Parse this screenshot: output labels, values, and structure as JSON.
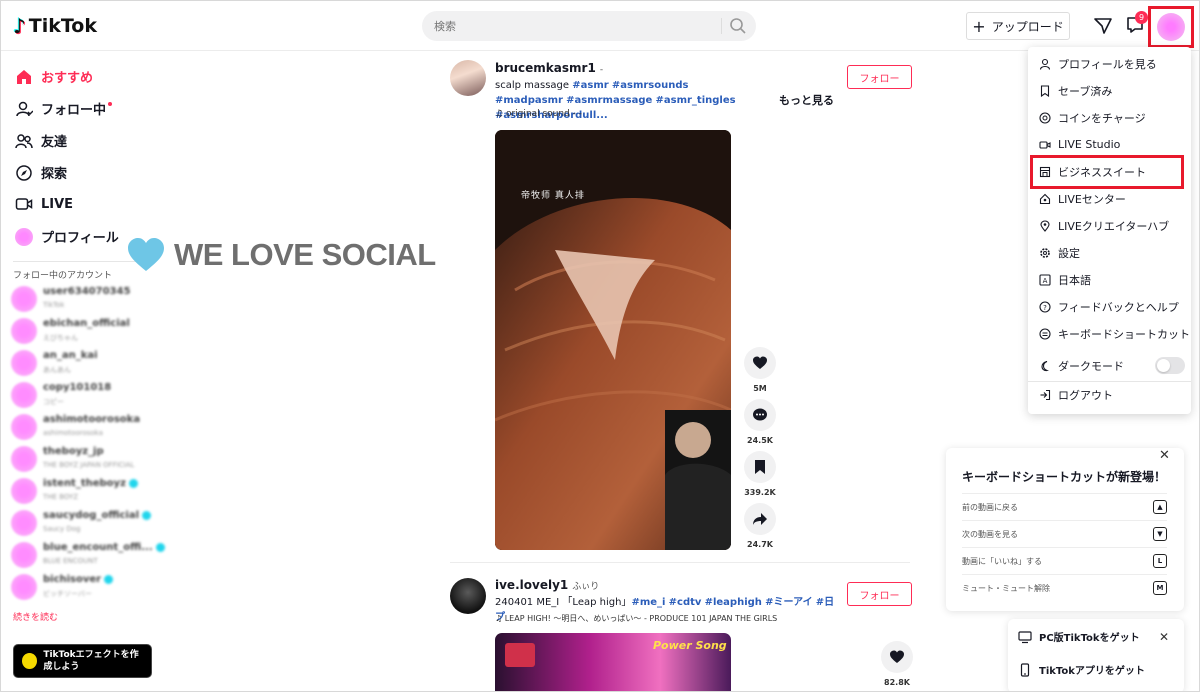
{
  "header": {
    "logo_text": "TikTok",
    "search_placeholder": "検索",
    "upload_label": "アップロード",
    "inbox_badge": "9"
  },
  "sidebar": {
    "nav": [
      {
        "label": "おすすめ",
        "icon": "home-icon",
        "active": true
      },
      {
        "label": "フォロー中",
        "icon": "following-icon"
      },
      {
        "label": "友達",
        "icon": "friends-icon"
      },
      {
        "label": "探索",
        "icon": "explore-icon"
      },
      {
        "label": "LIVE",
        "icon": "live-icon"
      },
      {
        "label": "プロフィール",
        "icon": "profile-avatar"
      }
    ],
    "following_heading": "フォロー中のアカウント",
    "accounts": [
      {
        "name": "user634070345",
        "sub": "TikTok"
      },
      {
        "name": "ebichan_official",
        "sub": "えびちゃん"
      },
      {
        "name": "an_an_kai",
        "sub": "あんあん"
      },
      {
        "name": "copy101018",
        "sub": "コピー"
      },
      {
        "name": "ashimotoorosoka",
        "sub": "ashimotoorosoka"
      },
      {
        "name": "theboyz_jp",
        "sub": "THE BOYZ JAPAN OFFICIAL"
      },
      {
        "name": "istent_theboyz",
        "sub": "THE BOYZ"
      },
      {
        "name": "saucydog_official",
        "sub": "Saucy Dog"
      },
      {
        "name": "blue_encount_offi...",
        "sub": "BLUE ENCOUNT"
      },
      {
        "name": "bichisover",
        "sub": "ビッチソーバー"
      }
    ],
    "see_more": "続きを読む",
    "effect_button": "TikTokエフェクトを作成しよう"
  },
  "watermark": "WE LOVE SOCIAL",
  "feed": {
    "more_label": "もっと見る",
    "posts": [
      {
        "username": "brucemkasmr1",
        "nickname": "-",
        "caption_prefix": "scalp massage ",
        "tags": [
          "#asmr",
          "#asmrsounds",
          "#madpasmr",
          "#asmrmassage",
          "#asmr_tingles",
          "#asmrsharpordull..."
        ],
        "sound": "original sound - -",
        "follow_label": "フォロー",
        "video_overlay": "帝牧师 真人排",
        "likes": "5M",
        "comments": "24.5K",
        "saves": "339.2K",
        "shares": "24.7K"
      },
      {
        "username": "ive.lovely1",
        "nickname": "ふぃり",
        "caption_prefix": "240401 ME_I 「Leap high」",
        "tags": [
          "#me_i",
          "#cdtv",
          "#leaphigh",
          "#ミーアイ",
          "#日プ"
        ],
        "sound": "LEAP HIGH! ～明日へ、めいっぱい～ - PRODUCE 101 JAPAN THE GIRLS",
        "follow_label": "フォロー",
        "video_overlay": "Power Song",
        "likes": "82.8K"
      }
    ]
  },
  "dropdown": {
    "items": [
      {
        "label": "プロフィールを見る",
        "icon": "user-icon"
      },
      {
        "label": "セーブ済み",
        "icon": "bookmark-icon"
      },
      {
        "label": "コインをチャージ",
        "icon": "coin-icon"
      },
      {
        "label": "LIVE Studio",
        "icon": "live-studio-icon"
      },
      {
        "label": "ビジネススイート",
        "icon": "business-suite-icon"
      },
      {
        "label": "LIVEセンター",
        "icon": "live-center-icon"
      },
      {
        "label": "LIVEクリエイターハブ",
        "icon": "creator-hub-icon"
      },
      {
        "label": "設定",
        "icon": "gear-icon"
      },
      {
        "label": "日本語",
        "icon": "language-icon"
      },
      {
        "label": "フィードバックとヘルプ",
        "icon": "help-icon"
      },
      {
        "label": "キーボードショートカット",
        "icon": "keyboard-icon"
      },
      {
        "label": "ダークモード",
        "icon": "moon-icon"
      },
      {
        "label": "ログアウト",
        "icon": "logout-icon"
      }
    ]
  },
  "shortcut_panel": {
    "title": "キーボードショートカットが新登場！",
    "rows": [
      {
        "label": "前の動画に戻る",
        "key": "▲"
      },
      {
        "label": "次の動画を見る",
        "key": "▼"
      },
      {
        "label": "動画に「いいね」する",
        "key": "L"
      },
      {
        "label": "ミュート・ミュート解除",
        "key": "M"
      }
    ]
  },
  "get_app": {
    "pc_label": "PC版TikTokをゲット",
    "app_label": "TikTokアプリをゲット"
  },
  "colors": {
    "accent": "#fe2c55",
    "highlight_box": "#e8192c",
    "tag": "#2b5db9"
  }
}
